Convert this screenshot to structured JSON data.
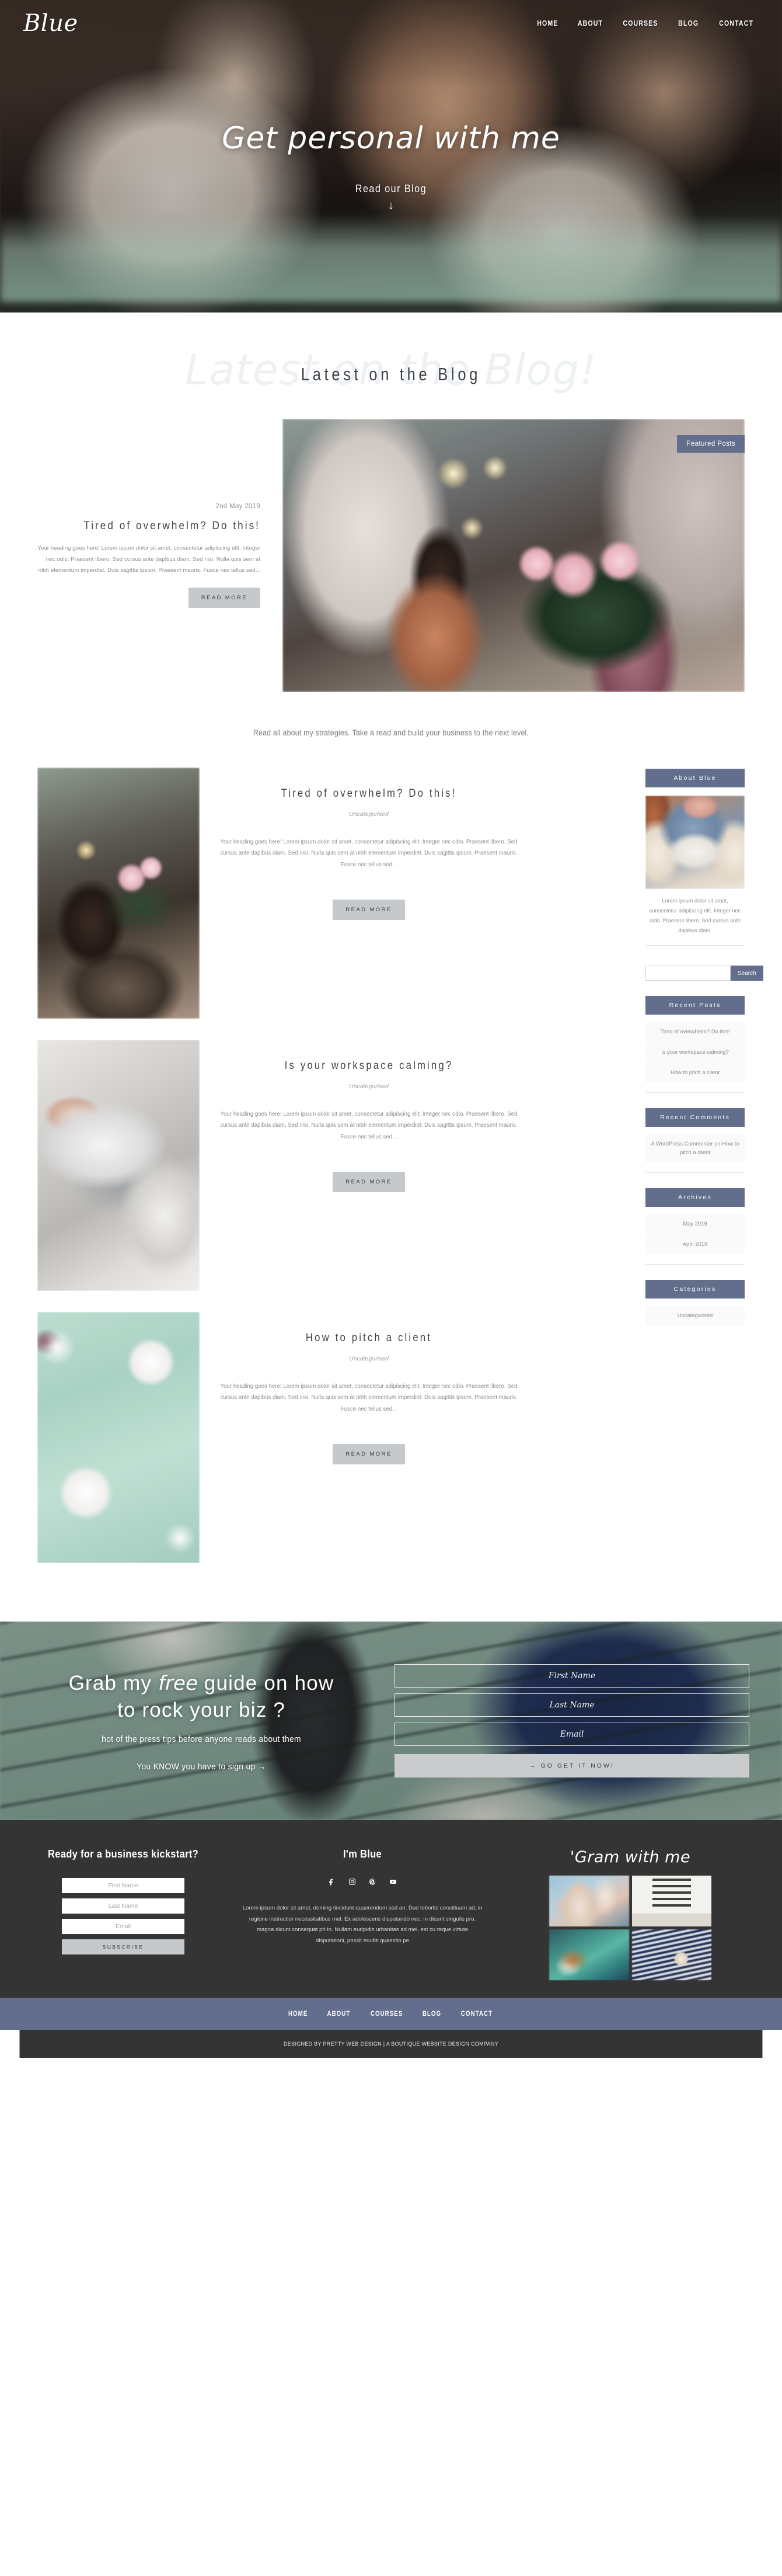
{
  "brand": {
    "logo": "Blue",
    "accent_color": "#626e8b",
    "button_color": "#c6c9cb",
    "footer_bg": "#343434"
  },
  "nav": {
    "items": [
      "HOME",
      "ABOUT",
      "COURSES",
      "BLOG",
      "CONTACT"
    ]
  },
  "hero": {
    "title": "Get personal with me",
    "cta": "Read our Blog",
    "arrow": "↓"
  },
  "latest": {
    "script_watermark": "Latest on the Blog!",
    "title": "Latest on the Blog"
  },
  "featured": {
    "badge": "Featured Posts",
    "date": "2nd May 2019",
    "title": "Tired of overwhelm? Do this!",
    "excerpt": "Your heading goes here! Lorem ipsum dolor sit amet, consectetur adipiscing elit. Integer nec odio. Praesent libero. Sed cursus ante dapibus diam. Sed nisi. Nulla quis sem at nibh elementum imperdiet. Duis sagittis ipsum. Praesent mauris. Fusce nec tellus sed...",
    "read_more": "READ MORE"
  },
  "tagline": "Read all about my strategies. Take a read and build your business to the next level.",
  "posts": [
    {
      "title": "Tired of overwhelm? Do this!",
      "category": "Uncategorised",
      "excerpt": "Your heading goes here!  Lorem ipsum dolor sit amet, consectetur adipiscing elit. Integer nec odio. Praesent libero. Sed cursus ante dapibus diam. Sed nisi. Nulla quis sem at nibh elementum imperdiet. Duis sagittis ipsum. Praesent mauris. Fusce nec tellus sed...",
      "read_more": "READ MORE"
    },
    {
      "title": "Is your workspace calming?",
      "category": "Uncategorised",
      "excerpt": "Your heading goes here!  Lorem ipsum dolor sit amet, consectetur adipiscing elit. Integer nec odio. Praesent libero. Sed cursus ante dapibus diam. Sed nisi. Nulla quis sem at nibh elementum imperdiet. Duis sagittis ipsum. Praesent mauris. Fusce nec tellus sed...",
      "read_more": "READ MORE"
    },
    {
      "title": "How to pitch a client",
      "category": "Uncategorised",
      "excerpt": "Your heading goes here!  Lorem ipsum dolor sit amet, consectetur adipiscing elit. Integer nec odio. Praesent libero. Sed cursus ante dapibus diam. Sed nisi. Nulla quis sem at nibh elementum imperdiet. Duis sagittis ipsum. Praesent mauris. Fusce nec tellus sed...",
      "read_more": "READ MORE"
    }
  ],
  "sidebar": {
    "about": {
      "heading": "About Blue",
      "text": "Lorem ipsum dolor sit amet, consectetur adipiscing elit. Integer nec odio. Praesent libero. Sed cursus ante dapibus diam."
    },
    "search": {
      "placeholder": "",
      "value": "",
      "button": "Search"
    },
    "recent_posts": {
      "heading": "Recent Posts",
      "items": [
        "Tired of overwhelm? Do this!",
        "Is your workspace calming?",
        "How to pitch a client"
      ]
    },
    "recent_comments": {
      "heading": "Recent Comments",
      "items": [
        "A WordPress Commenter on How to pitch a client"
      ]
    },
    "archives": {
      "heading": "Archives",
      "items": [
        "May 2019",
        "April 2019"
      ]
    },
    "categories": {
      "heading": "Categories",
      "items": [
        "Uncategorised"
      ]
    }
  },
  "optin": {
    "heading_1": "Grab my ",
    "heading_free": "free",
    "heading_2": " guide on how",
    "heading_3": "to rock your biz ?",
    "subheading": "hot of the press tips before anyone reads about them",
    "note": "You KNOW you have to sign up →",
    "fields": {
      "first_name": "First Name",
      "last_name": "Last Name",
      "email": "Email"
    },
    "submit": "→  GO GET IT NOW!"
  },
  "footer": {
    "subscribe": {
      "heading": "Ready for a business kickstart?",
      "first_name": "First Name",
      "last_name": "Last Name",
      "email": "Email",
      "button": "SUBSCRIBE"
    },
    "about": {
      "heading": "I'm Blue",
      "social": [
        "facebook-icon",
        "instagram-icon",
        "pinterest-icon",
        "youtube-icon"
      ],
      "text": "Lorem ipsum dolor sit amet, doming tincidunt quaerendum sed an. Duo lobortis constituam ad, in regione instructior necessitatibus mel. Ex adolescens disputando nec, in dicunt singulis pro, magna dicunt consequat pri in. Nullam euripidis urbanitas ad mei, est cu reque virtute disputationi, possit eruditi quaestio pe"
    },
    "gram": {
      "heading": "'Gram with me"
    },
    "nav": [
      "HOME",
      "ABOUT",
      "COURSES",
      "BLOG",
      "CONTACT"
    ],
    "copyright": "DESIGNED BY PRETTY WEB DESIGN | A BOUTIQUE WEBSITE DESIGN COMPANY"
  }
}
